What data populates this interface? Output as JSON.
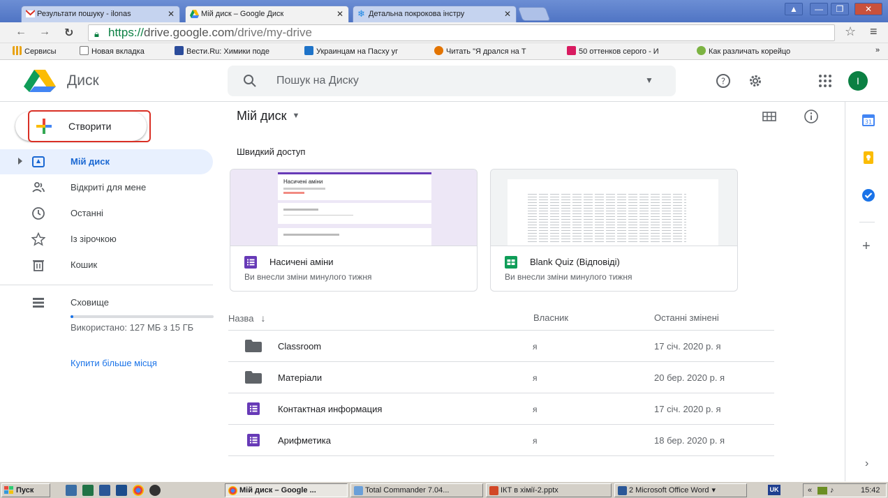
{
  "browser": {
    "tabs": [
      {
        "label": "Результати пошуку - ilonas",
        "icon": "gmail-icon",
        "active": false
      },
      {
        "label": "Мій диск – Google Диск",
        "icon": "drive-icon",
        "active": true
      },
      {
        "label": "Детальна покрокова інстру",
        "icon": "snowflake-icon",
        "active": false
      }
    ],
    "url_scheme": "https://",
    "url_host": "drive.google.com",
    "url_path": "/drive/my-drive",
    "bookmarks": [
      {
        "label": "Сервисы",
        "icon": "apps-grid-icon",
        "color": "#e8a317"
      },
      {
        "label": "Новая вкладка",
        "icon": "page-icon",
        "color": "#ffffff"
      },
      {
        "label": "Вести.Ru: Химики поде",
        "icon": "vesti-icon",
        "color": "#2b4c9b"
      },
      {
        "label": "Украинцам на Пасху уг",
        "icon": "news-icon",
        "color": "#1e73c8"
      },
      {
        "label": "Читать \"Я дрался на Т",
        "icon": "circle-icon",
        "color": "#e37400"
      },
      {
        "label": "50 оттенков серого - И",
        "icon": "dress-icon",
        "color": "#d81b60"
      },
      {
        "label": "Как различать корейцо",
        "icon": "green-circle-icon",
        "color": "#7cb342"
      }
    ],
    "bookmarks_more": "»"
  },
  "drive": {
    "app_title": "Диск",
    "search_placeholder": "Пошук на Диску",
    "avatar_letter": "I",
    "create_label": "Створити",
    "nav": [
      {
        "label": "Мій диск",
        "icon": "my-drive-icon",
        "active": true
      },
      {
        "label": "Відкриті для мене",
        "icon": "shared-icon",
        "active": false
      },
      {
        "label": "Останні",
        "icon": "clock-icon",
        "active": false
      },
      {
        "label": "Із зірочкою",
        "icon": "star-icon",
        "active": false
      },
      {
        "label": "Кошик",
        "icon": "trash-icon",
        "active": false
      }
    ],
    "storage_label": "Сховище",
    "storage_used_text": "Використано: 127 МБ з 15 ГБ",
    "storage_used_fraction": 0.01,
    "buy_storage": "Купити більше місця",
    "breadcrumb": "Мій диск",
    "quick_access_title": "Швидкий доступ",
    "quick_access": [
      {
        "name": "Насичені аміни",
        "subtitle": "Ви внесли зміни минулого тижня",
        "type": "form",
        "preview_title": "Насичені аміни"
      },
      {
        "name": "Blank Quiz (Відповіді)",
        "subtitle": "Ви внесли зміни минулого тижня",
        "type": "sheet"
      }
    ],
    "columns": {
      "name": "Назва",
      "owner": "Власник",
      "modified": "Останні змінені"
    },
    "files": [
      {
        "name": "Classroom",
        "owner": "я",
        "modified": "17 січ. 2020 р. я",
        "type": "folder"
      },
      {
        "name": "Матеріали",
        "owner": "я",
        "modified": "20 бер. 2020 р. я",
        "type": "folder"
      },
      {
        "name": "Контактная информация",
        "owner": "я",
        "modified": "17 січ. 2020 р. я",
        "type": "form"
      },
      {
        "name": "Арифметика",
        "owner": "я",
        "modified": "18 бер. 2020 р. я",
        "type": "form"
      }
    ],
    "colors": {
      "accent": "#1a73e8",
      "active_bg": "#e8f0fe",
      "form": "#673ab7",
      "sheet": "#0f9d58",
      "folder": "#5f6368",
      "highlight": "#d93025"
    }
  },
  "taskbar": {
    "start_label": "Пуск",
    "items": [
      {
        "label": "Мій диск – Google ...",
        "active": true,
        "icon": "chrome-icon"
      },
      {
        "label": "Total Commander 7.04...",
        "active": false,
        "icon": "total-commander-icon"
      },
      {
        "label": "ІКТ в хімії-2.pptx",
        "active": false,
        "icon": "powerpoint-icon"
      },
      {
        "label": "2 Microsoft Office Word",
        "active": false,
        "icon": "word-icon"
      }
    ],
    "language": "UK",
    "tray_arrows": "«",
    "time": "15:42"
  }
}
